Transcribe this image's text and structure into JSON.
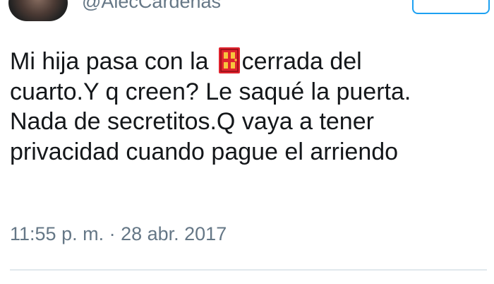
{
  "author": {
    "handle": "@AlecCardenas"
  },
  "tweet": {
    "lines": [
      {
        "before_icon": "Mi hija pasa con la",
        "icon": "door-icon",
        "after_icon": "cerrada del"
      },
      {
        "text": "cuarto.Y q creen? Le saqué la puerta."
      },
      {
        "text": "Nada de secretitos.Q vaya a tener"
      },
      {
        "text": "privacidad cuando pague el arriendo"
      }
    ],
    "timestamp": "11:55 p. m. · 28 abr. 2017"
  },
  "colors": {
    "text": "#14171a",
    "muted": "#657786",
    "accent": "#1da1f2",
    "door": "#e0242f",
    "divider": "#e1e8ed"
  }
}
